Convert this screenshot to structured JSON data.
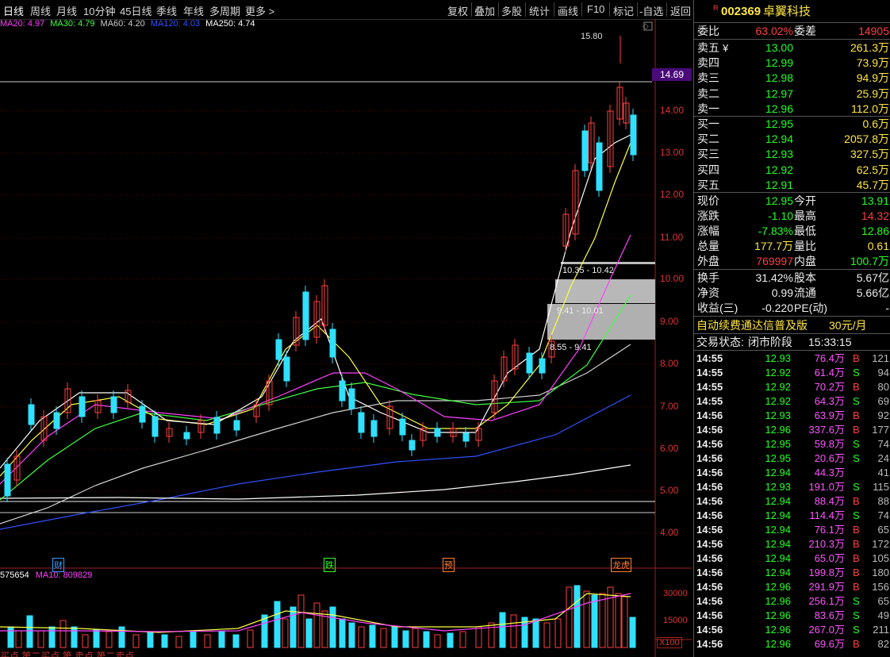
{
  "toolbar": {
    "periods": [
      "日线",
      "周线",
      "月线",
      "10分钟",
      "45日线",
      "季线",
      "年线",
      "多周期",
      "更多 >"
    ],
    "active_period": "日线",
    "actions": [
      "复权",
      "叠加",
      "多股",
      "统计",
      "画线",
      "F10",
      "标记",
      "-自选",
      "返回"
    ]
  },
  "ma_legend": [
    {
      "text": "MA20: 4.97",
      "color": "#ff40ff"
    },
    {
      "text": "MA30: 4.79",
      "color": "#40ff40"
    },
    {
      "text": "MA60: 4.20",
      "color": "#cccccc"
    },
    {
      "text": "MA120: 4.03",
      "color": "#3050ff"
    },
    {
      "text": "MA250: 4.74",
      "color": "#ffffff"
    }
  ],
  "y_axis": [
    "14.00",
    "13.00",
    "12.00",
    "11.00",
    "10.00",
    "9.00",
    "8.00",
    "7.00",
    "6.00",
    "5.00",
    "4.00"
  ],
  "price_marker": "14.69",
  "high_label": "15.80",
  "levels": [
    {
      "text": "10.35 - 10.42"
    },
    {
      "text": "9.41 - 10.01"
    },
    {
      "text": "8.55 - 9.41"
    }
  ],
  "events": [
    {
      "text": "财",
      "color": "#30a0ff"
    },
    {
      "text": "跌",
      "color": "#30ff30"
    },
    {
      "text": "预",
      "color": "#ff8030"
    },
    {
      "text": "龙虎",
      "color": "#ff8030"
    }
  ],
  "volume": {
    "legend": [
      {
        "text": "575654",
        "color": "#ffffff"
      },
      {
        "text": "MA10: 809829",
        "color": "#ff40ff"
      }
    ],
    "y_axis": [
      "30000",
      "15000"
    ],
    "unit": "X100"
  },
  "bottom_strip": "买点 第二买点 第 卖点 第二卖点",
  "stock": {
    "badge": "R",
    "code": "002369",
    "name": "卓翼科技"
  },
  "weibi": {
    "label1": "委比",
    "value1": "63.02%",
    "label2": "委差",
    "value2": "14905"
  },
  "sells": [
    {
      "label": "卖五",
      "price": "13.00",
      "vol": "261.3万",
      "mark": "¥"
    },
    {
      "label": "卖四",
      "price": "12.99",
      "vol": "73.9万",
      "mark": ""
    },
    {
      "label": "卖三",
      "price": "12.98",
      "vol": "94.9万",
      "mark": ""
    },
    {
      "label": "卖二",
      "price": "12.97",
      "vol": "25.9万",
      "mark": ""
    },
    {
      "label": "卖一",
      "price": "12.96",
      "vol": "112.0万",
      "mark": ""
    }
  ],
  "buys": [
    {
      "label": "买一",
      "price": "12.95",
      "vol": "0.6万"
    },
    {
      "label": "买二",
      "price": "12.94",
      "vol": "2057.8万"
    },
    {
      "label": "买三",
      "price": "12.93",
      "vol": "327.5万"
    },
    {
      "label": "买四",
      "price": "12.92",
      "vol": "62.5万"
    },
    {
      "label": "买五",
      "price": "12.91",
      "vol": "45.7万"
    }
  ],
  "quote": [
    {
      "l1": "现价",
      "v1": "12.95",
      "c1": "green",
      "l2": "今开",
      "v2": "13.91",
      "c2": "green"
    },
    {
      "l1": "涨跌",
      "v1": "-1.10",
      "c1": "green",
      "l2": "最高",
      "v2": "14.32",
      "c2": "red"
    },
    {
      "l1": "涨幅",
      "v1": "-7.83%",
      "c1": "green",
      "l2": "最低",
      "v2": "12.86",
      "c2": "green"
    },
    {
      "l1": "总量",
      "v1": "177.7万",
      "c1": "yellow",
      "l2": "量比",
      "v2": "0.61",
      "c2": "yellow"
    },
    {
      "l1": "外盘",
      "v1": "769997",
      "c1": "red",
      "l2": "内盘",
      "v2": "100.7万",
      "c2": "green"
    }
  ],
  "fundamentals": [
    {
      "l1": "换手",
      "v1": "31.42%",
      "l2": "股本",
      "v2": "5.67亿"
    },
    {
      "l1": "净资",
      "v1": "0.99",
      "l2": "流通",
      "v2": "5.66亿"
    },
    {
      "l1": "收益(三)",
      "v1": "-0.220",
      "l2": "PE(动)",
      "v2": "-"
    }
  ],
  "promo": {
    "text": "自动续费通达信普及版",
    "price": "30元/月"
  },
  "trade_status": {
    "label": "交易状态:",
    "value": "闭市阶段",
    "time": "15:33:15"
  },
  "ticks": [
    {
      "t": "14:55",
      "p": "12.93",
      "v": "76.4万",
      "d": "B",
      "n": "121"
    },
    {
      "t": "14:55",
      "p": "12.92",
      "v": "61.4万",
      "d": "S",
      "n": "94"
    },
    {
      "t": "14:55",
      "p": "12.92",
      "v": "70.2万",
      "d": "B",
      "n": "80"
    },
    {
      "t": "14:55",
      "p": "12.92",
      "v": "64.3万",
      "d": "S",
      "n": "69"
    },
    {
      "t": "14:56",
      "p": "12.93",
      "v": "63.9万",
      "d": "B",
      "n": "92"
    },
    {
      "t": "14:56",
      "p": "12.96",
      "v": "337.6万",
      "d": "B",
      "n": "177"
    },
    {
      "t": "14:56",
      "p": "12.95",
      "v": "59.8万",
      "d": "S",
      "n": "74"
    },
    {
      "t": "14:56",
      "p": "12.95",
      "v": "20.6万",
      "d": "S",
      "n": "24"
    },
    {
      "t": "14:56",
      "p": "12.94",
      "v": "44.3万",
      "d": "",
      "n": "41"
    },
    {
      "t": "14:56",
      "p": "12.93",
      "v": "191.0万",
      "d": "S",
      "n": "115"
    },
    {
      "t": "14:56",
      "p": "12.94",
      "v": "88.4万",
      "d": "B",
      "n": "88"
    },
    {
      "t": "14:56",
      "p": "12.94",
      "v": "114.4万",
      "d": "S",
      "n": "74"
    },
    {
      "t": "14:56",
      "p": "12.94",
      "v": "76.1万",
      "d": "B",
      "n": "65"
    },
    {
      "t": "14:56",
      "p": "12.94",
      "v": "210.3万",
      "d": "B",
      "n": "172"
    },
    {
      "t": "14:56",
      "p": "12.94",
      "v": "65.0万",
      "d": "B",
      "n": "105"
    },
    {
      "t": "14:56",
      "p": "12.94",
      "v": "199.8万",
      "d": "B",
      "n": "180"
    },
    {
      "t": "14:56",
      "p": "12.96",
      "v": "291.9万",
      "d": "B",
      "n": "156"
    },
    {
      "t": "14:56",
      "p": "12.96",
      "v": "256.1万",
      "d": "S",
      "n": "65"
    },
    {
      "t": "14:56",
      "p": "12.96",
      "v": "83.6万",
      "d": "S",
      "n": "49"
    },
    {
      "t": "14:56",
      "p": "12.96",
      "v": "267.0万",
      "d": "S",
      "n": "211"
    },
    {
      "t": "14:56",
      "p": "12.96",
      "v": "69.6万",
      "d": "B",
      "n": "82"
    }
  ]
}
